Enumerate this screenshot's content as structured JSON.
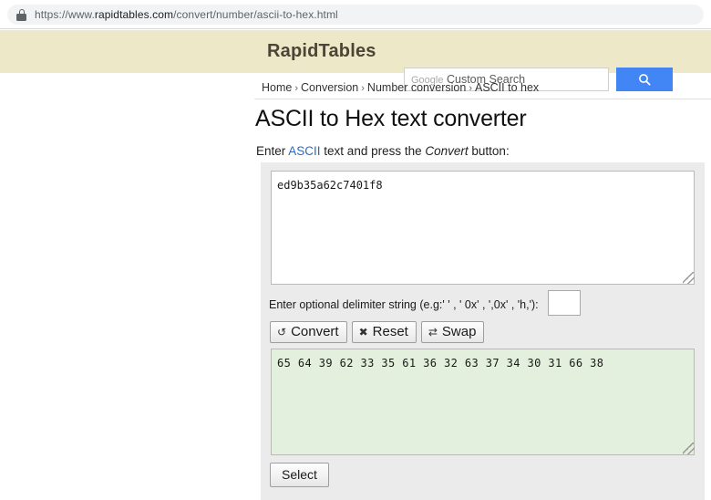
{
  "browser": {
    "url_scheme_prefix": "https://www.",
    "url_domain": "rapidtables.com",
    "url_path": "/convert/number/ascii-to-hex.html",
    "lock_icon": "lock-icon"
  },
  "header": {
    "logo": "RapidTables",
    "search_placeholder_brand": "Google",
    "search_placeholder_rest": "Custom Search",
    "search_value": "",
    "search_icon": "search-icon",
    "search_button_color": "#4285f4",
    "band_color": "#ece8c8"
  },
  "breadcrumb": {
    "items": [
      {
        "label": "Home"
      },
      {
        "label": "Conversion"
      },
      {
        "label": "Number conversion"
      },
      {
        "label": "ASCII to hex"
      }
    ],
    "separator": "›"
  },
  "main": {
    "title": "ASCII to Hex text converter",
    "instruction_prefix": "Enter ",
    "instruction_link": "ASCII",
    "instruction_middle": " text and press the ",
    "instruction_emphasis": "Convert",
    "instruction_suffix": " button:",
    "input_value": "ed9b35a62c7401f8",
    "delimiter_label": "Enter optional delimiter string (e.g:' ' , ' 0x' , ',0x' , 'h,'):",
    "delimiter_value": "",
    "buttons": [
      {
        "label": "Convert",
        "icon": "refresh-icon",
        "glyph": "↺"
      },
      {
        "label": "Reset",
        "icon": "cross-icon",
        "glyph": "✖"
      },
      {
        "label": "Swap",
        "icon": "swap-icon",
        "glyph": "⇄"
      }
    ],
    "output_value": "65 64 39 62 33 35 61 36 32 63 37 34 30 31 66 38",
    "output_background": "#e4f0de",
    "select_button_label": "Select",
    "panel_background": "#ebebeb"
  }
}
